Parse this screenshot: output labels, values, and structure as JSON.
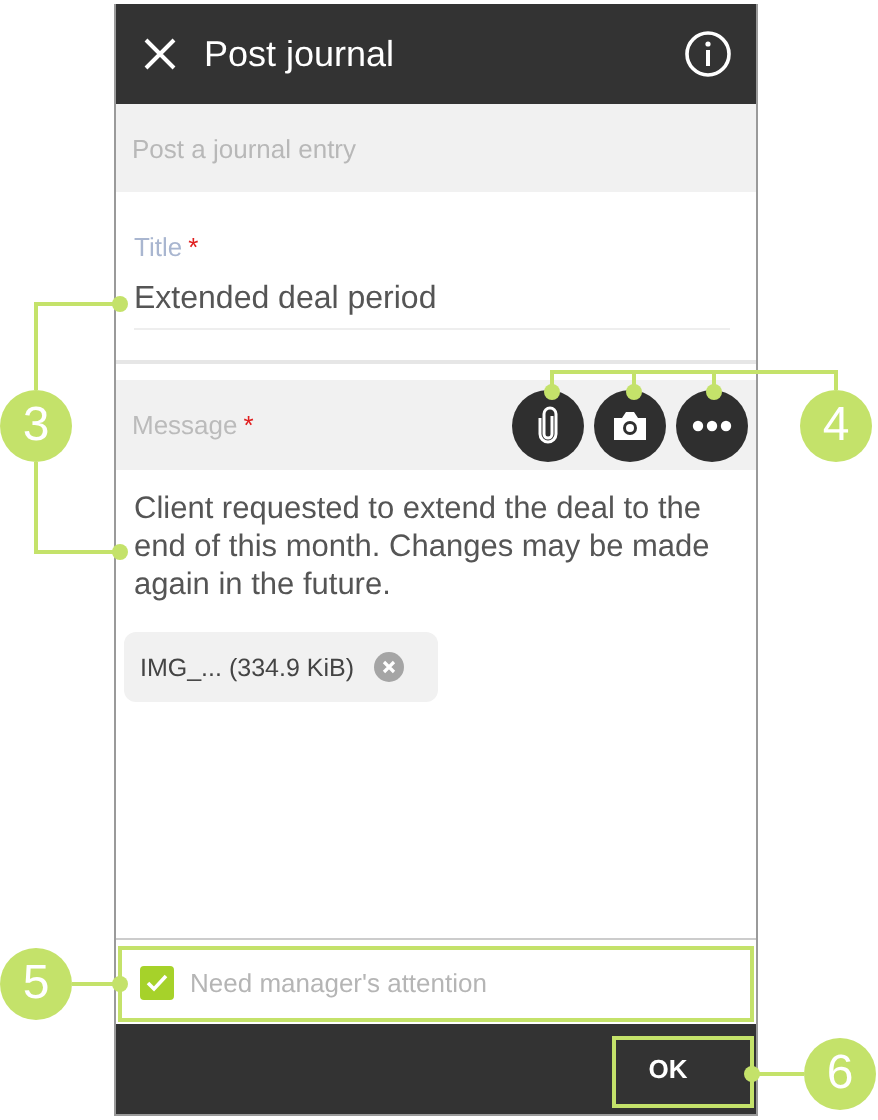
{
  "header": {
    "title": "Post journal"
  },
  "subtitle": "Post a journal entry",
  "title_field": {
    "label": "Title",
    "required_mark": "*",
    "value": "Extended deal period"
  },
  "message": {
    "label": "Message",
    "required_mark": "*",
    "text": "Client requested to extend the deal to the end of this month. Changes may be made again in the future.",
    "actions": [
      {
        "kind": "attach"
      },
      {
        "kind": "camera"
      },
      {
        "kind": "more"
      }
    ]
  },
  "attachment": {
    "name": "IMG_... (334.9 KiB)"
  },
  "attention": {
    "label": "Need manager's attention",
    "checked": true
  },
  "buttons": [
    "OK"
  ],
  "callouts": [
    {
      "number": "3",
      "kind": "fields"
    },
    {
      "number": "4",
      "kind": "actions"
    },
    {
      "number": "5",
      "kind": "attention"
    },
    {
      "number": "6",
      "kind": "ok"
    }
  ]
}
